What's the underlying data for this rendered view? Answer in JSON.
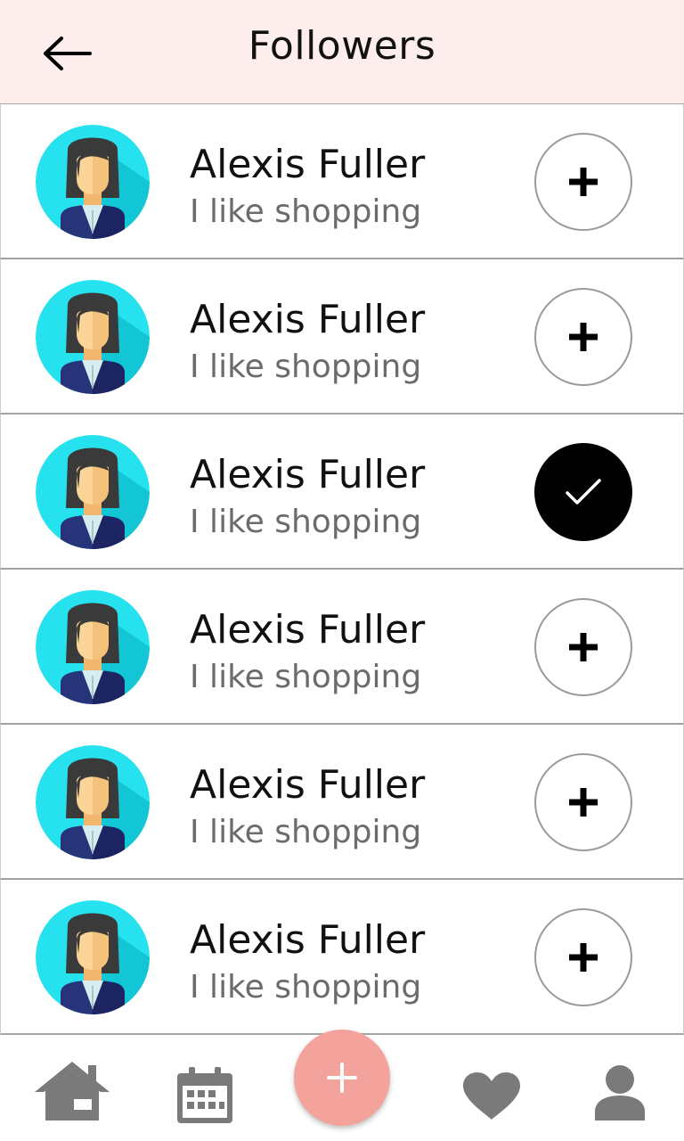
{
  "header": {
    "title": "Followers",
    "back_icon": "arrow-left-icon"
  },
  "followers": [
    {
      "name": "Alexis Fuller",
      "bio": "I like shopping",
      "followed": false
    },
    {
      "name": "Alexis Fuller",
      "bio": "I like shopping",
      "followed": false
    },
    {
      "name": "Alexis Fuller",
      "bio": "I like shopping",
      "followed": true
    },
    {
      "name": "Alexis Fuller",
      "bio": "I like shopping",
      "followed": false
    },
    {
      "name": "Alexis Fuller",
      "bio": "I like shopping",
      "followed": false
    },
    {
      "name": "Alexis Fuller",
      "bio": "I like shopping",
      "followed": false
    }
  ],
  "bottom_nav": {
    "items": [
      {
        "icon": "home-icon"
      },
      {
        "icon": "calendar-icon"
      },
      {
        "icon": "plus-icon"
      },
      {
        "icon": "heart-icon"
      },
      {
        "icon": "profile-icon"
      }
    ]
  },
  "colors": {
    "header_bg": "#fdeded",
    "fab_bg": "#f4a39c",
    "nav_icon": "#7a7a7a",
    "avatar_bg": "#26e2ef"
  }
}
